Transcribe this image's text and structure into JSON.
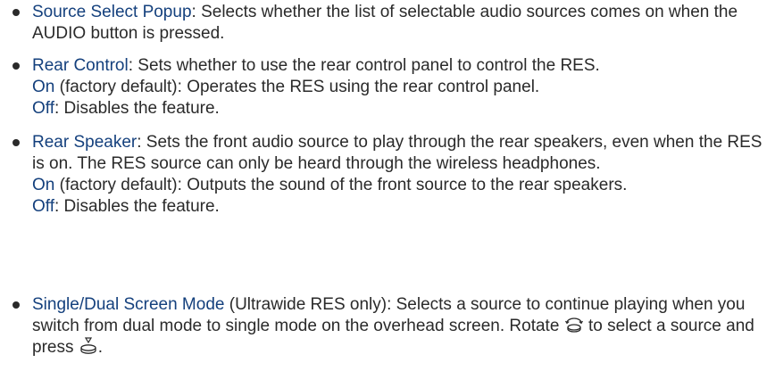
{
  "items": [
    {
      "term": "Source Select Popup",
      "text": ": Selects whether the list of selectable audio sources comes on when the AUDIO button is pressed."
    },
    {
      "term": "Rear Control",
      "text": ": Sets whether to use the rear control panel to control the RES.",
      "options": [
        {
          "term": "On",
          "text": " (factory default): Operates the RES using the rear control panel."
        },
        {
          "term": "Off",
          "text": ": Disables the feature."
        }
      ]
    },
    {
      "term": "Rear Speaker",
      "text": ": Sets the front audio source to play through the rear speakers, even when the RES is on. The RES source can only be heard through the wireless headphones.",
      "options": [
        {
          "term": "On",
          "text": " (factory default): Outputs the sound of the front source to the rear speakers."
        },
        {
          "term": "Off",
          "text": ": Disables the feature."
        }
      ]
    },
    {
      "term": "Single/Dual Screen Mode",
      "text": " (Ultrawide RES only): Selects a source to continue playing when you switch from dual mode to single mode on the overhead screen.",
      "rotate_text": "Rotate ",
      "rotate_icon": "rotate-knob-icon",
      "select_text": " to select a source and press ",
      "press_icon": "press-knob-icon",
      "end_text": "."
    }
  ],
  "colors": {
    "term": "#14407d",
    "body": "#2a2a2a"
  }
}
